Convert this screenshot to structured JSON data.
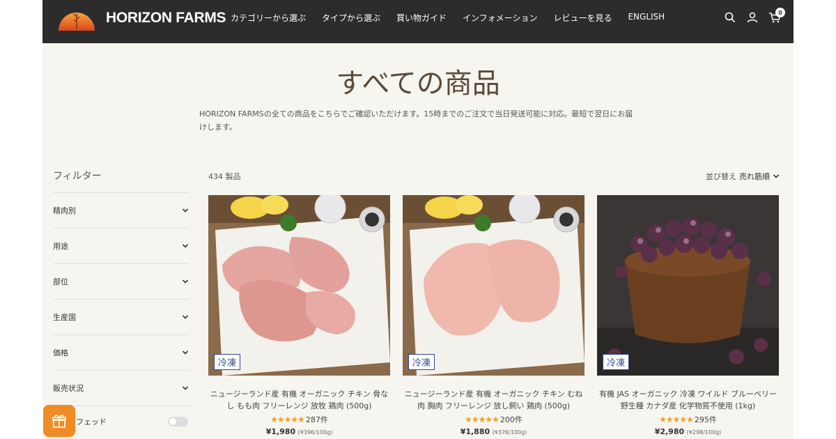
{
  "header": {
    "brand": "HORIZON FARMS",
    "nav": [
      "カテゴリーから選ぶ",
      "タイプから選ぶ",
      "買い物ガイド",
      "インフォメーション",
      "レビューを見る",
      "ENGLISH"
    ],
    "cart_count": "0",
    "icons": [
      "search-icon",
      "account-icon",
      "cart-icon"
    ]
  },
  "page": {
    "title": "すべての商品",
    "description": "HORIZON FARMSの全ての商品をこちらでご確認いただけます。15時までのご注文で当日発送可能に対応。最短で翌日にお届けします。"
  },
  "filters": {
    "title": "フィルター",
    "items": [
      "精肉別",
      "用途",
      "部位",
      "生産国",
      "価格",
      "販売状況"
    ],
    "toggle_label": "フェッド"
  },
  "listing": {
    "count": "434 製品",
    "sort_label": "並び替え",
    "sort_value": "売れ筋順"
  },
  "products": [
    {
      "tag": "冷凍",
      "name": "ニュージーランド産 有機 オーガニック チキン 骨なし もも肉 フリーレンジ 放牧 鶏肉 (500g)",
      "stars": "★★★★★",
      "reviews": "287件",
      "price": "¥1,980",
      "unit": "(¥396/100g)"
    },
    {
      "tag": "冷凍",
      "name": "ニュージーランド産 有機 オーガニック チキン むね肉 胸肉 フリーレンジ 放し飼い 鶏肉 (500g)",
      "stars": "★★★★★",
      "reviews": "200件",
      "price": "¥1,880",
      "unit": "(¥376/100g)"
    },
    {
      "tag": "冷凍",
      "name": "有機 JAS オーガニック 冷凍 ワイルド ブルーベリー 野生種 カナダ産 化学物質不使用 (1kg)",
      "stars": "★★★★★",
      "reviews": "295件",
      "price": "¥2,980",
      "unit": "(¥298/100g)"
    }
  ],
  "colors": {
    "header_bg": "#2c2c2c",
    "page_bg": "#f7f5ef",
    "star": "#f0a020",
    "gift_button": "#f08c28",
    "tag_border": "#2a4a8a"
  }
}
